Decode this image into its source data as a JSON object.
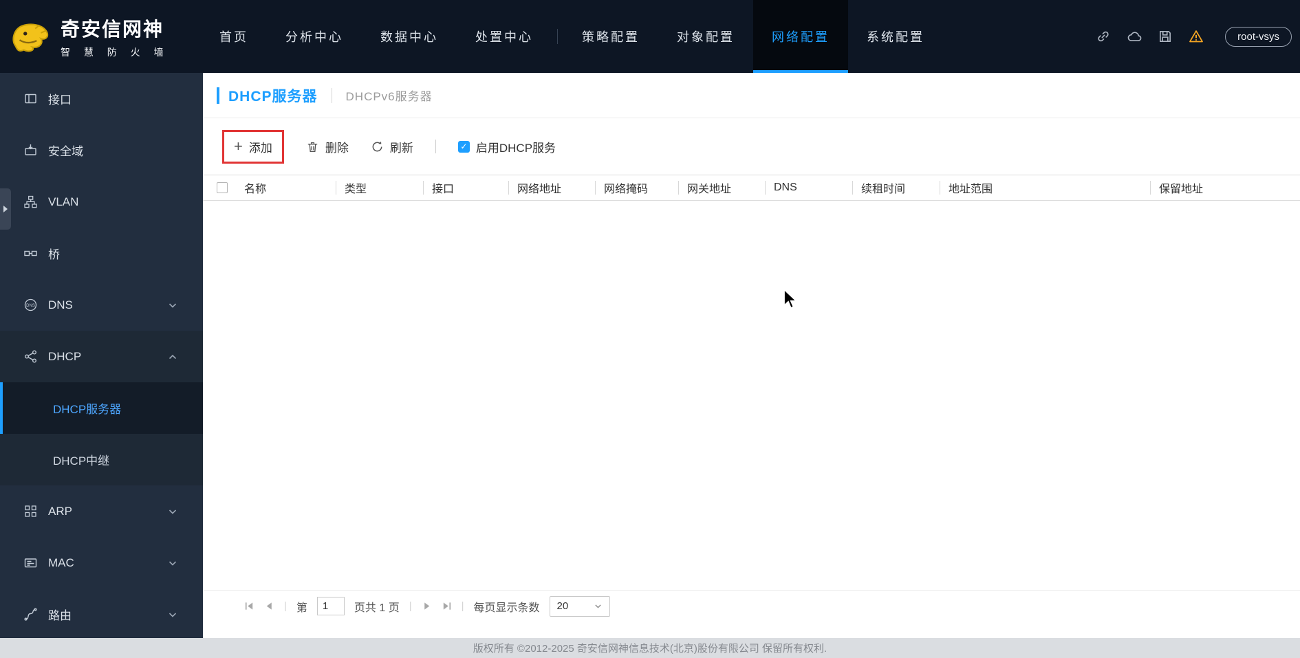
{
  "colors": {
    "accent": "#1e9fff",
    "annotation_red": "#e13535",
    "warning": "#f5a623",
    "topbar_bg": "#0d1624",
    "sidebar_bg": "#222e3f"
  },
  "icons": {
    "plus": "+",
    "check": "✓"
  },
  "topbar": {
    "logo": {
      "title": "奇安信网神",
      "subtitle": "智 慧 防 火 墙"
    },
    "nav": [
      "首页",
      "分析中心",
      "数据中心",
      "处置中心",
      "策略配置",
      "对象配置",
      "网络配置",
      "系统配置"
    ],
    "vsys": "root-vsys"
  },
  "sidebar": {
    "items": [
      {
        "label": "接口"
      },
      {
        "label": "安全域"
      },
      {
        "label": "VLAN"
      },
      {
        "label": "桥"
      },
      {
        "label": "DNS"
      },
      {
        "label": "DHCP"
      },
      {
        "label": "DHCP服务器"
      },
      {
        "label": "DHCP中继"
      },
      {
        "label": "ARP"
      },
      {
        "label": "MAC"
      },
      {
        "label": "路由"
      }
    ]
  },
  "main": {
    "tabs": [
      {
        "label": "DHCP服务器"
      },
      {
        "label": "DHCPv6服务器"
      }
    ],
    "toolbar": {
      "add": "添加",
      "delete": "删除",
      "refresh": "刷新",
      "enable_dhcp": "启用DHCP服务"
    },
    "table": {
      "columns": [
        "名称",
        "类型",
        "接口",
        "网络地址",
        "网络掩码",
        "网关地址",
        "DNS",
        "续租时间",
        "地址范围",
        "保留地址"
      ],
      "rows": []
    },
    "pagination": {
      "page_label": "第",
      "page_value": "1",
      "total_label": "页共 1 页",
      "size_label": "每页显示条数",
      "size_value": "20"
    }
  },
  "footer": {
    "copyright": "版权所有 ©2012-2025 奇安信网神信息技术(北京)股份有限公司 保留所有权利."
  }
}
